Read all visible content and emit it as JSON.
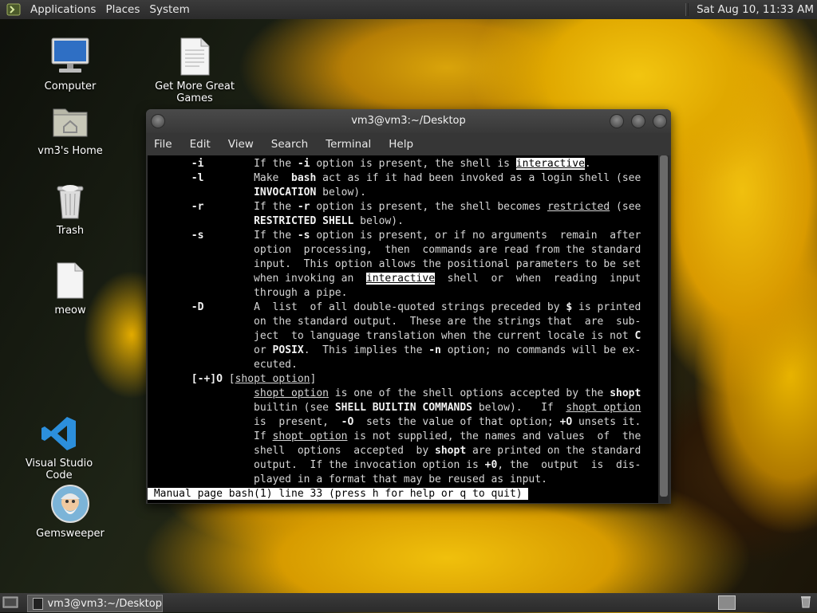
{
  "top_panel": {
    "menus": [
      "Applications",
      "Places",
      "System"
    ],
    "clock": "Sat Aug 10, 11:33 AM"
  },
  "desktop_icons": {
    "computer": "Computer",
    "games": "Get More Great Games",
    "home": "vm3's Home",
    "trash": "Trash",
    "meow": "meow",
    "vscode": "Visual Studio Code",
    "gemsweeper": "Gemsweeper"
  },
  "window": {
    "title": "vm3@vm3:~/Desktop",
    "menu": [
      "File",
      "Edit",
      "View",
      "Search",
      "Terminal",
      "Help"
    ]
  },
  "terminal": {
    "lines": [
      [
        {
          "t": "       "
        },
        {
          "t": "-i",
          "s": "b"
        },
        {
          "t": "        If the "
        },
        {
          "t": "-i",
          "s": "b"
        },
        {
          "t": " option is present, the shell is "
        },
        {
          "t": "interactive",
          "s": "hl"
        },
        {
          "t": "."
        }
      ],
      [
        {
          "t": "       "
        },
        {
          "t": "-l",
          "s": "b"
        },
        {
          "t": "        Make  "
        },
        {
          "t": "bash",
          "s": "b"
        },
        {
          "t": " act as if it had been invoked as a login shell (see"
        }
      ],
      [
        {
          "t": "                 "
        },
        {
          "t": "INVOCATION",
          "s": "b"
        },
        {
          "t": " below)."
        }
      ],
      [
        {
          "t": "       "
        },
        {
          "t": "-r",
          "s": "b"
        },
        {
          "t": "        If the "
        },
        {
          "t": "-r",
          "s": "b"
        },
        {
          "t": " option is present, the shell becomes "
        },
        {
          "t": "restricted",
          "s": "u"
        },
        {
          "t": " (see"
        }
      ],
      [
        {
          "t": "                 "
        },
        {
          "t": "RESTRICTED SHELL",
          "s": "b"
        },
        {
          "t": " below)."
        }
      ],
      [
        {
          "t": "       "
        },
        {
          "t": "-s",
          "s": "b"
        },
        {
          "t": "        If the "
        },
        {
          "t": "-s",
          "s": "b"
        },
        {
          "t": " option is present, or if no arguments  remain  after"
        }
      ],
      [
        {
          "t": "                 option  processing,  then  commands are read from the standard"
        }
      ],
      [
        {
          "t": "                 input.  This option allows the positional parameters to be set"
        }
      ],
      [
        {
          "t": "                 when invoking an  "
        },
        {
          "t": "interactive",
          "s": "hl"
        },
        {
          "t": "  shell  or  when  reading  input"
        }
      ],
      [
        {
          "t": "                 through a pipe."
        }
      ],
      [
        {
          "t": "       "
        },
        {
          "t": "-D",
          "s": "b"
        },
        {
          "t": "        A  list  of all double-quoted strings preceded by "
        },
        {
          "t": "$",
          "s": "b"
        },
        {
          "t": " is printed"
        }
      ],
      [
        {
          "t": "                 on the standard output.  These are the strings that  are  sub-"
        }
      ],
      [
        {
          "t": "                 ject  to language translation when the current locale is not "
        },
        {
          "t": "C",
          "s": "b"
        }
      ],
      [
        {
          "t": "                 or "
        },
        {
          "t": "POSIX",
          "s": "b"
        },
        {
          "t": ".  This implies the "
        },
        {
          "t": "-n",
          "s": "b"
        },
        {
          "t": " option; no commands will be ex-"
        }
      ],
      [
        {
          "t": "                 ecuted."
        }
      ],
      [
        {
          "t": "       "
        },
        {
          "t": "[-+]O",
          "s": "b"
        },
        {
          "t": " ["
        },
        {
          "t": "shopt option",
          "s": "u"
        },
        {
          "t": "]"
        }
      ],
      [
        {
          "t": "                 "
        },
        {
          "t": "shopt option",
          "s": "u"
        },
        {
          "t": " is one of the shell options accepted by the "
        },
        {
          "t": "shopt",
          "s": "b"
        }
      ],
      [
        {
          "t": "                 builtin (see "
        },
        {
          "t": "SHELL BUILTIN COMMANDS",
          "s": "b"
        },
        {
          "t": " below).   If  "
        },
        {
          "t": "shopt option",
          "s": "u"
        }
      ],
      [
        {
          "t": "                 is  present,  "
        },
        {
          "t": "-O",
          "s": "b"
        },
        {
          "t": "  sets the value of that option; "
        },
        {
          "t": "+O",
          "s": "b"
        },
        {
          "t": " unsets it."
        }
      ],
      [
        {
          "t": "                 If "
        },
        {
          "t": "shopt option",
          "s": "u"
        },
        {
          "t": " is not supplied, the names and values  of  the"
        }
      ],
      [
        {
          "t": "                 shell  options  accepted  by "
        },
        {
          "t": "shopt",
          "s": "b"
        },
        {
          "t": " are printed on the standard"
        }
      ],
      [
        {
          "t": "                 output.  If the invocation option is "
        },
        {
          "t": "+0",
          "s": "b"
        },
        {
          "t": ", the  output  is  dis-"
        }
      ],
      [
        {
          "t": "                 played in a format that may be reused as input."
        }
      ]
    ],
    "status_line": " Manual page bash(1) line 33 (press h for help or q to quit) "
  },
  "taskbar": {
    "task_label": "vm3@vm3:~/Desktop"
  }
}
